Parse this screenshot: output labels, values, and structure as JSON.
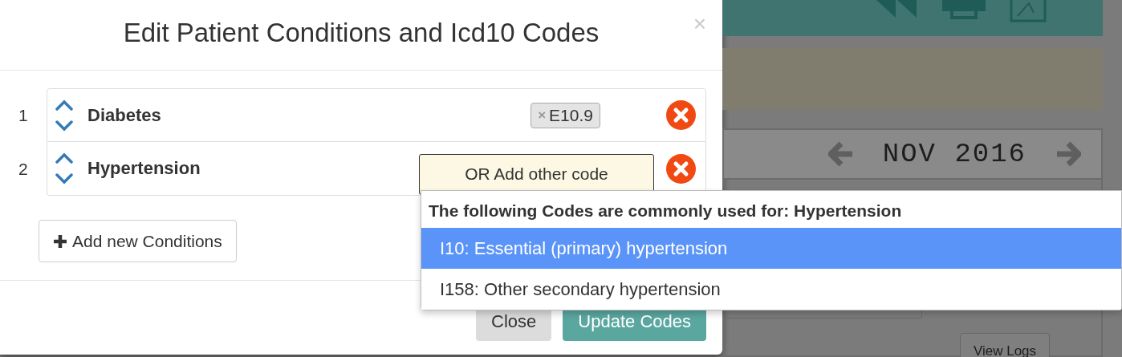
{
  "dialog": {
    "title": "Edit Patient Conditions and Icd10 Codes",
    "close": "×",
    "conditions": [
      {
        "number": "1",
        "name": "Diabetes",
        "codes": [
          {
            "label": "E10.9",
            "remove": "×"
          }
        ]
      },
      {
        "number": "2",
        "name": "Hypertension",
        "code_input": {
          "value": "OR Add other code"
        }
      }
    ],
    "add_button": "Add new Conditions",
    "footer_buttons": [
      {
        "label": "Close",
        "kind": "secondary"
      },
      {
        "label": "Update Codes",
        "kind": "primary"
      }
    ]
  },
  "suggestions": {
    "heading": "The following Codes are commonly used for: Hypertension",
    "options": [
      {
        "label": "I10: Essential (primary) hypertension",
        "selected": true
      },
      {
        "label": "I158: Other secondary hypertension",
        "selected": false
      }
    ]
  },
  "background": {
    "month": "NOV 2016",
    "button": "View Logs"
  }
}
